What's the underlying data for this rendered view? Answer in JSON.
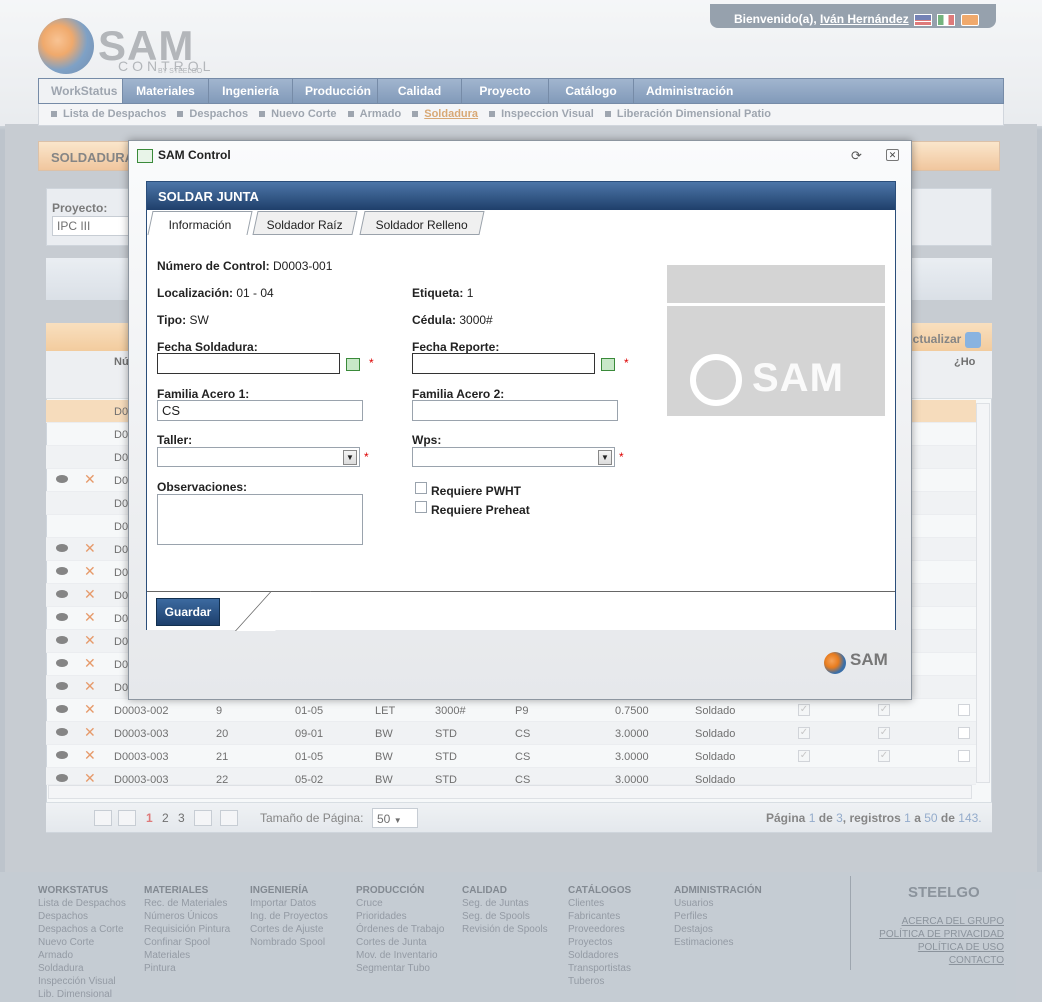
{
  "header": {
    "welcome_prefix": "Bienvenido(a),",
    "user_name": "Iván Hernández",
    "logo_text": "SAM",
    "logo_sub": "CONTROL",
    "logo_sub2": "BY STEELGO"
  },
  "nav": {
    "items": [
      "WorkStatus",
      "Materiales",
      "Ingeniería",
      "Producción",
      "Calidad",
      "Proyecto",
      "Catálogo",
      "Administración"
    ],
    "subitems": [
      "Lista de Despachos",
      "Despachos",
      "Nuevo Corte",
      "Armado",
      "Soldadura",
      "Inspeccion Visual",
      "Liberación Dimensional Patio"
    ]
  },
  "page": {
    "title": "SOLDADURA",
    "project_label": "Proyecto:",
    "project_value": "IPC III",
    "actualizar": "Actualizar",
    "col_header_1": "Nú",
    "col_header_2": "¿Ho"
  },
  "grid": {
    "rows": [
      {
        "code": "D0003-002",
        "num": "9",
        "loc": "01-05",
        "tipo": "LET",
        "ced": "3000#",
        "fam": "P9",
        "val": "0.7500",
        "status": "Soldado"
      },
      {
        "code": "D0003-003",
        "num": "20",
        "loc": "09-01",
        "tipo": "BW",
        "ced": "STD",
        "fam": "CS",
        "val": "3.0000",
        "status": "Soldado"
      },
      {
        "code": "D0003-003",
        "num": "21",
        "loc": "01-05",
        "tipo": "BW",
        "ced": "STD",
        "fam": "CS",
        "val": "3.0000",
        "status": "Soldado"
      },
      {
        "code": "D0003-003",
        "num": "22",
        "loc": "05-02",
        "tipo": "BW",
        "ced": "STD",
        "fam": "CS",
        "val": "3.0000",
        "status": "Soldado"
      }
    ],
    "partial_code": "D0"
  },
  "pager": {
    "pages": [
      "1",
      "2",
      "3"
    ],
    "size_label": "Tamaño de Página:",
    "size_value": "50",
    "info_prefix": "Página",
    "info_page": "1",
    "info_de": "de",
    "info_total_pages": "3",
    "info_reg": ", registros",
    "info_from": "1",
    "info_a": "a",
    "info_to": "50",
    "info_de2": "de",
    "info_total": "143."
  },
  "modal": {
    "window_title": "SAM Control",
    "form_title": "SOLDAR JUNTA",
    "tabs": [
      "Información",
      "Soldador Raíz",
      "Soldador Relleno"
    ],
    "numero_control_label": "Número de Control:",
    "numero_control_value": "D0003-001",
    "localizacion_label": "Localización:",
    "localizacion_value": "01 - 04",
    "etiqueta_label": "Etiqueta:",
    "etiqueta_value": "1",
    "tipo_label": "Tipo:",
    "tipo_value": "SW",
    "cedula_label": "Cédula:",
    "cedula_value": "3000#",
    "fecha_soldadura_label": "Fecha Soldadura:",
    "fecha_reporte_label": "Fecha Reporte:",
    "familia1_label": "Familia Acero 1:",
    "familia1_value": "CS",
    "familia2_label": "Familia Acero 2:",
    "taller_label": "Taller:",
    "wps_label": "Wps:",
    "observaciones_label": "Observaciones:",
    "pwht_label": "Requiere PWHT",
    "preheat_label": "Requiere Preheat",
    "guardar": "Guardar",
    "required_mark": "*",
    "watermark": "SAM",
    "mini_logo": "SAM"
  },
  "footer": {
    "columns": [
      {
        "title": "WORKSTATUS",
        "links": [
          "Lista de Despachos",
          "Despachos",
          "Despachos a Corte",
          "Nuevo Corte",
          "Armado",
          "Soldadura",
          "Inspección Visual",
          "Lib. Dimensional"
        ]
      },
      {
        "title": "MATERIALES",
        "links": [
          "Rec. de Materiales",
          "Números Únicos",
          "Requisición Pintura",
          "Confinar Spool",
          "Materiales",
          "Pintura"
        ]
      },
      {
        "title": "INGENIERÍA",
        "links": [
          "Importar Datos",
          "Ing. de Proyectos",
          "Cortes de Ajuste",
          "Nombrado Spool"
        ]
      },
      {
        "title": "PRODUCCIÓN",
        "links": [
          "Cruce",
          "Prioridades",
          "Órdenes de Trabajo",
          "Cortes de Junta",
          "Mov. de Inventario",
          "Segmentar Tubo"
        ]
      },
      {
        "title": "CALIDAD",
        "links": [
          "Seg. de Juntas",
          "Seg. de Spools",
          "Revisión de Spools"
        ]
      },
      {
        "title": "CATÁLOGOS",
        "links": [
          "Clientes",
          "Fabricantes",
          "Proveedores",
          "Proyectos",
          "Soldadores",
          "Transportistas",
          "Tuberos"
        ]
      },
      {
        "title": "ADMINISTRACIÓN",
        "links": [
          "Usuarios",
          "Perfiles",
          "Destajos",
          "Estimaciones"
        ]
      }
    ],
    "brand": "STEELGO",
    "links": [
      "ACERCA DEL GRUPO",
      "POLÍTICA DE PRIVACIDAD",
      "POLÍTICA DE USO",
      "CONTACTO"
    ]
  }
}
